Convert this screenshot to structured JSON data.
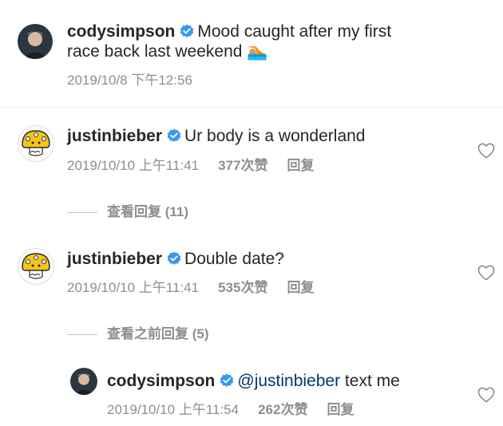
{
  "post": {
    "username": "codysimpson",
    "caption_line1": "Mood caught after my first",
    "caption_line2": "race back last weekend",
    "caption_emoji": "🏊🏼",
    "timestamp": "2019/10/8 下午12:56"
  },
  "comments": [
    {
      "username": "justinbieber",
      "text": "Ur body is a wonderland",
      "timestamp": "2019/10/10 上午11:41",
      "likes": "377次赞",
      "reply_label": "回复",
      "view_replies": "查看回复 (11)"
    },
    {
      "username": "justinbieber",
      "text": "Double date?",
      "timestamp": "2019/10/10 上午11:41",
      "likes": "535次赞",
      "reply_label": "回复",
      "view_replies": "查看之前回复 (5)"
    }
  ],
  "reply": {
    "username": "codysimpson",
    "mention": "@justinbieber",
    "text": " text me",
    "timestamp": "2019/10/10 上午11:54",
    "likes": "262次赞",
    "reply_label": "回复"
  },
  "colors": {
    "verified": "#3897f0",
    "mention": "#00376b",
    "muted": "#8e8e8e",
    "mushroom": "#f5c518"
  },
  "icons": {
    "verified": "verified-badge-icon",
    "heart": "heart-outline-icon",
    "avatar_cody": "profile-photo",
    "avatar_drew": "drew-mushroom-logo"
  }
}
